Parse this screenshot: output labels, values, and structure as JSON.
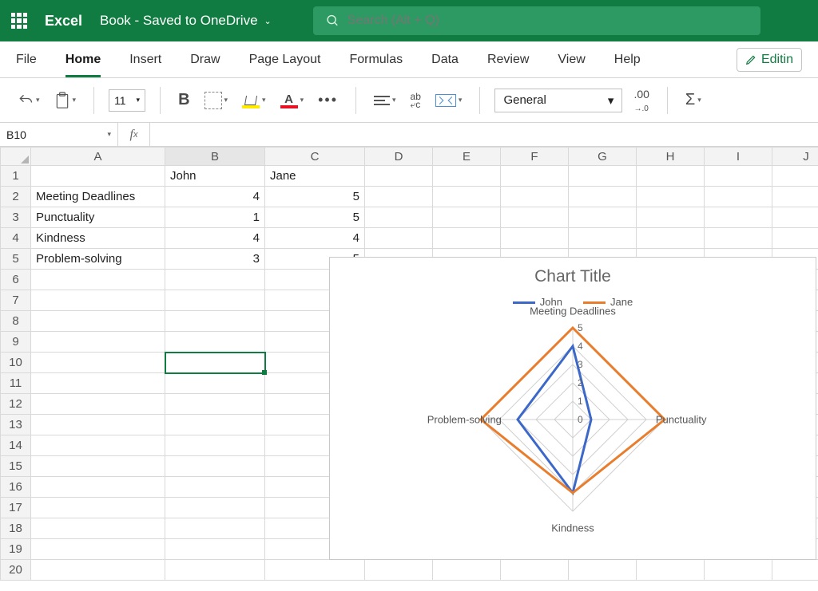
{
  "titlebar": {
    "app": "Excel",
    "doc": "Book  -  Saved to OneDrive"
  },
  "search": {
    "placeholder": "Search (Alt + Q)"
  },
  "tabs": [
    "File",
    "Home",
    "Insert",
    "Draw",
    "Page Layout",
    "Formulas",
    "Data",
    "Review",
    "View",
    "Help"
  ],
  "active_tab": "Home",
  "editing_label": "Editin",
  "ribbon": {
    "font_size": "11",
    "number_format": "General"
  },
  "namebox": "B10",
  "columns": [
    "A",
    "B",
    "C",
    "D",
    "E",
    "F",
    "G",
    "H",
    "I",
    "J"
  ],
  "row_count": 20,
  "cells": {
    "B1": "John",
    "C1": "Jane",
    "A2": "Meeting Deadlines",
    "B2": "4",
    "C2": "5",
    "A3": "Punctuality",
    "B3": "1",
    "C3": "5",
    "A4": "Kindness",
    "B4": "4",
    "C4": "4",
    "A5": "Problem-solving",
    "B5": "3",
    "C5": "5"
  },
  "selected_cell": "B10",
  "chart_data": {
    "type": "radar",
    "title": "Chart Title",
    "categories": [
      "Meeting Deadlines",
      "Punctuality",
      "Kindness",
      "Problem-solving"
    ],
    "series": [
      {
        "name": "John",
        "color": "#3b68c9",
        "values": [
          4,
          1,
          4,
          3
        ]
      },
      {
        "name": "Jane",
        "color": "#e97d2e",
        "values": [
          5,
          5,
          4,
          5
        ]
      }
    ],
    "ticks": [
      0,
      1,
      2,
      3,
      4,
      5
    ],
    "r_max": 5
  }
}
